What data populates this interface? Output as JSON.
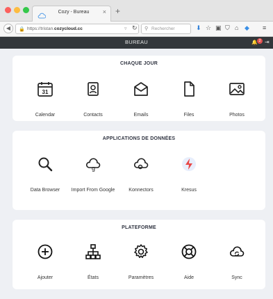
{
  "browser": {
    "tab_title": "Cozy - Bureau",
    "tab_close": "×",
    "new_tab": "+",
    "url_prefix": "https://tristan.",
    "url_domain": "cozycloud.cc",
    "search_placeholder": "Rechercher"
  },
  "header": {
    "title": "BUREAU",
    "notification_count": "2"
  },
  "sections": [
    {
      "title": "CHAQUE JOUR",
      "apps": [
        {
          "label": "Calendar",
          "icon": "calendar-icon",
          "color": "#ef7a5c",
          "calendar_day": "31"
        },
        {
          "label": "Contacts",
          "icon": "contacts-icon",
          "color": "#7be06a"
        },
        {
          "label": "Emails",
          "icon": "email-icon",
          "color": "#86ea8a"
        },
        {
          "label": "Files",
          "icon": "file-icon",
          "color": "#94b4f6"
        },
        {
          "label": "Photos",
          "icon": "photo-icon",
          "color": "#d3a78e"
        }
      ]
    },
    {
      "title": "APPLICATIONS DE DONNÉES",
      "apps": [
        {
          "label": "Data Browser",
          "icon": "search-icon",
          "color": "#ef7a5c"
        },
        {
          "label": "Import From Google",
          "icon": "cloud-google-icon",
          "color": "#c4bceb"
        },
        {
          "label": "Konnectors",
          "icon": "cloud-connector-icon",
          "color": "#e3607a"
        },
        {
          "label": "Kresus",
          "icon": "bolt-icon",
          "color": "#93b8f6"
        }
      ]
    },
    {
      "title": "PLATEFORME",
      "apps": [
        {
          "label": "Ajouter",
          "icon": "plus-circle-icon",
          "color": "#4f93ee"
        },
        {
          "label": "États",
          "icon": "sitemap-icon",
          "color": "#4f93ee"
        },
        {
          "label": "Paramètres",
          "icon": "gear-icon",
          "color": "#4f93ee"
        },
        {
          "label": "Aide",
          "icon": "lifebuoy-icon",
          "color": "#4f93ee"
        },
        {
          "label": "Sync",
          "icon": "cloud-sync-icon",
          "color": "#6ee0b6"
        }
      ]
    }
  ]
}
